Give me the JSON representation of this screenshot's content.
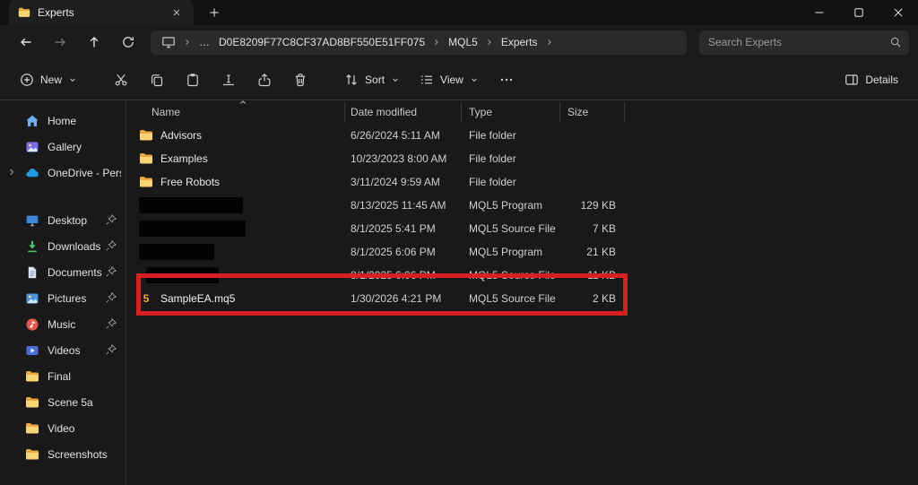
{
  "titlebar": {
    "tab_label": "Experts"
  },
  "navbar": {
    "breadcrumb": {
      "ellipsis": "…",
      "items": [
        "D0E8209F77C8CF37AD8BF550E51FF075",
        "MQL5",
        "Experts"
      ]
    },
    "search_placeholder": "Search Experts"
  },
  "toolbar": {
    "new_label": "New",
    "sort_label": "Sort",
    "view_label": "View",
    "details_label": "Details"
  },
  "sidebar": {
    "top": [
      {
        "label": "Home"
      },
      {
        "label": "Gallery"
      },
      {
        "label": "OneDrive - Persona"
      }
    ],
    "pinned": [
      {
        "label": "Desktop"
      },
      {
        "label": "Downloads"
      },
      {
        "label": "Documents"
      },
      {
        "label": "Pictures"
      },
      {
        "label": "Music"
      },
      {
        "label": "Videos"
      }
    ],
    "folders": [
      {
        "label": "Final"
      },
      {
        "label": "Scene 5a"
      },
      {
        "label": "Video"
      },
      {
        "label": "Screenshots"
      }
    ]
  },
  "filelist": {
    "columns": {
      "name": "Name",
      "date": "Date modified",
      "type": "Type",
      "size": "Size"
    },
    "rows": [
      {
        "name": "Advisors",
        "date": "6/26/2024 5:11 AM",
        "type": "File folder",
        "size": ""
      },
      {
        "name": "Examples",
        "date": "10/23/2023 8:00 AM",
        "type": "File folder",
        "size": ""
      },
      {
        "name": "Free Robots",
        "date": "3/11/2024 9:59 AM",
        "type": "File folder",
        "size": ""
      },
      {
        "name": "",
        "date": "8/13/2025 11:45 AM",
        "type": "MQL5 Program",
        "size": "129 KB"
      },
      {
        "name": "",
        "date": "8/1/2025 5:41 PM",
        "type": "MQL5 Source File",
        "size": "7 KB"
      },
      {
        "name": "",
        "date": "8/1/2025 6:06 PM",
        "type": "MQL5 Program",
        "size": "21 KB"
      },
      {
        "name": "",
        "date": "8/1/2025 6:06 PM",
        "type": "MQL5 Source File",
        "size": "11 KB"
      },
      {
        "name": "SampleEA.mq5",
        "date": "1/30/2026 4:21 PM",
        "type": "MQL5 Source File",
        "size": "2 KB"
      }
    ],
    "mq5_icon_glyph": "5"
  },
  "colors": {
    "highlight_red": "#d92020",
    "folder_yellow": "#f6c64e",
    "mq5_orange": "#f0a732"
  }
}
